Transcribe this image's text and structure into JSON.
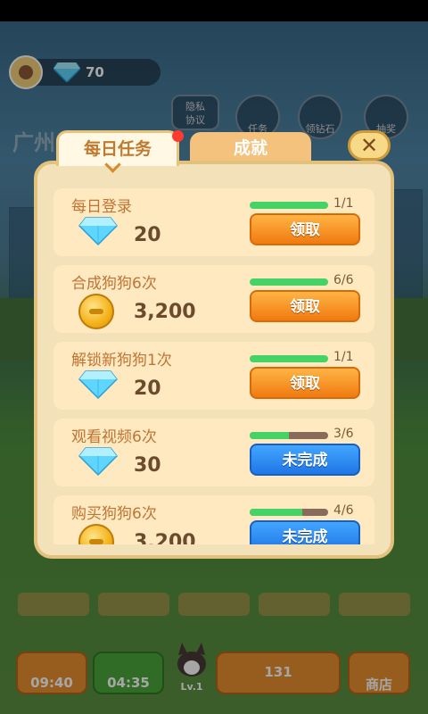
{
  "hud": {
    "gem_count": "70",
    "city": "广州"
  },
  "bg_buttons": {
    "privacy": "隐私\n协议",
    "tasks": "任务",
    "collect": "领钻石",
    "prize": "抽奖"
  },
  "tabs": {
    "daily": "每日任务",
    "achievements": "成就"
  },
  "close_icon": "close-x",
  "tasks": [
    {
      "title": "每日登录",
      "reward": "20",
      "reward_icon": "diamond",
      "progress": "1/1",
      "progress_fraction": 1.0,
      "button": "领取",
      "status": "claim"
    },
    {
      "title": "合成狗狗6次",
      "reward": "3,200",
      "reward_icon": "coin",
      "progress": "6/6",
      "progress_fraction": 1.0,
      "button": "领取",
      "status": "claim"
    },
    {
      "title": "解锁新狗狗1次",
      "reward": "20",
      "reward_icon": "diamond",
      "progress": "1/1",
      "progress_fraction": 1.0,
      "button": "领取",
      "status": "claim"
    },
    {
      "title": "观看视频6次",
      "reward": "30",
      "reward_icon": "diamond",
      "progress": "3/6",
      "progress_fraction": 0.5,
      "button": "未完成",
      "status": "incomplete"
    },
    {
      "title": "购买狗狗6次",
      "reward": "3,200",
      "reward_icon": "coin",
      "progress": "4/6",
      "progress_fraction": 0.667,
      "button": "未完成",
      "status": "incomplete"
    }
  ],
  "bottom": {
    "timer1": "09:40",
    "timer2": "04:35",
    "level": "Lv.1",
    "buy_amount": "131",
    "shop": "商店"
  },
  "colors": {
    "claim_button": "#f07a10",
    "incomplete_button": "#1f76e6",
    "progress_fill": "#46d365",
    "panel_bg": "#f3e2b9",
    "row_bg": "#ffe9c0"
  }
}
